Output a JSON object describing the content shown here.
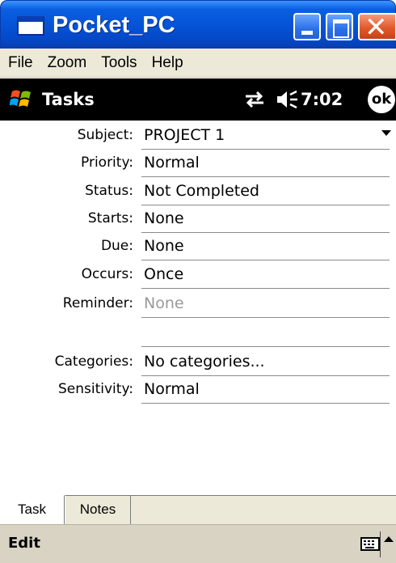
{
  "window": {
    "title": "Pocket_PC"
  },
  "menu": {
    "items": [
      "File",
      "Zoom",
      "Tools",
      "Help"
    ]
  },
  "navbar": {
    "app_title": "Tasks",
    "time": "7:02",
    "ok_label": "ok"
  },
  "form": {
    "fields": [
      {
        "label": "Subject:",
        "value": "PROJECT 1"
      },
      {
        "label": "Priority:",
        "value": "Normal"
      },
      {
        "label": "Status:",
        "value": "Not Completed"
      },
      {
        "label": "Starts:",
        "value": "None"
      },
      {
        "label": "Due:",
        "value": "None"
      },
      {
        "label": "Occurs:",
        "value": "Once"
      },
      {
        "label": "Reminder:",
        "value": "None"
      },
      {
        "label": "",
        "value": ""
      },
      {
        "label": "Categories:",
        "value": "No categories..."
      },
      {
        "label": "Sensitivity:",
        "value": "Normal"
      }
    ]
  },
  "tabs": [
    "Task",
    "Notes"
  ],
  "bottom": {
    "menu_label": "Edit"
  },
  "icons": {
    "app": "window-icon",
    "start": "windows-flag-icon",
    "sync": "sync-arrows-icon",
    "volume": "speaker-icon",
    "keyboard": "keyboard-icon",
    "sip": "chevron-up-icon"
  },
  "colors": {
    "titlebar": "#0552d6",
    "close_button": "#e05a2b",
    "navbar": "#000000",
    "menubar": "#ece9d8"
  }
}
